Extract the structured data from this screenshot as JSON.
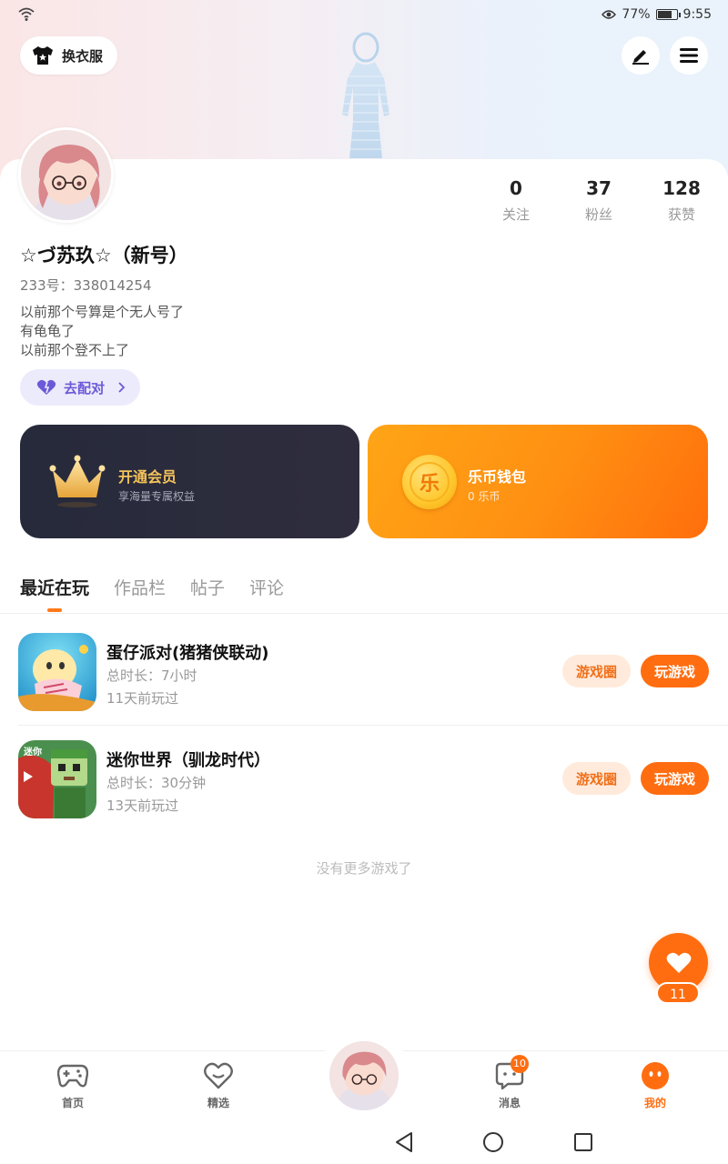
{
  "status": {
    "battery_pct": "77%",
    "time": "9:55",
    "battery_level": 0.77
  },
  "header": {
    "dress_label": "换衣服"
  },
  "profile": {
    "stats": [
      {
        "num": "0",
        "label": "关注"
      },
      {
        "num": "37",
        "label": "粉丝"
      },
      {
        "num": "128",
        "label": "获赞"
      }
    ],
    "username": "☆づ苏玖☆（新号）",
    "uid": "233号：338014254",
    "bio": [
      "以前那个号算是个无人号了",
      "有龟龟了",
      "以前那个登不上了"
    ],
    "pair_label": "去配对"
  },
  "cards": {
    "vip": {
      "title": "开通会员",
      "subtitle": "享海量专属权益"
    },
    "wallet": {
      "title": "乐币钱包",
      "subtitle": "0 乐币",
      "coin_char": "乐"
    }
  },
  "tabs": [
    "最近在玩",
    "作品栏",
    "帖子",
    "评论"
  ],
  "games": [
    {
      "name": "蛋仔派对(猪猪侠联动)",
      "duration": "总时长：7小时",
      "last_played": "11天前玩过",
      "circle_label": "游戏圈",
      "play_label": "玩游戏"
    },
    {
      "name": "迷你世界（驯龙时代）",
      "duration": "总时长：30分钟",
      "last_played": "13天前玩过",
      "circle_label": "游戏圈",
      "play_label": "玩游戏"
    }
  ],
  "no_more_text": "没有更多游戏了",
  "favorite": {
    "count": "11"
  },
  "bottom_nav": {
    "home": "首页",
    "featured": "精选",
    "messages": "消息",
    "messages_badge": "10",
    "mine": "我的"
  },
  "colors": {
    "accent": "#ff6d10",
    "pair_purple": "#6a5ad8",
    "vip_gold": "#f4c35a"
  }
}
